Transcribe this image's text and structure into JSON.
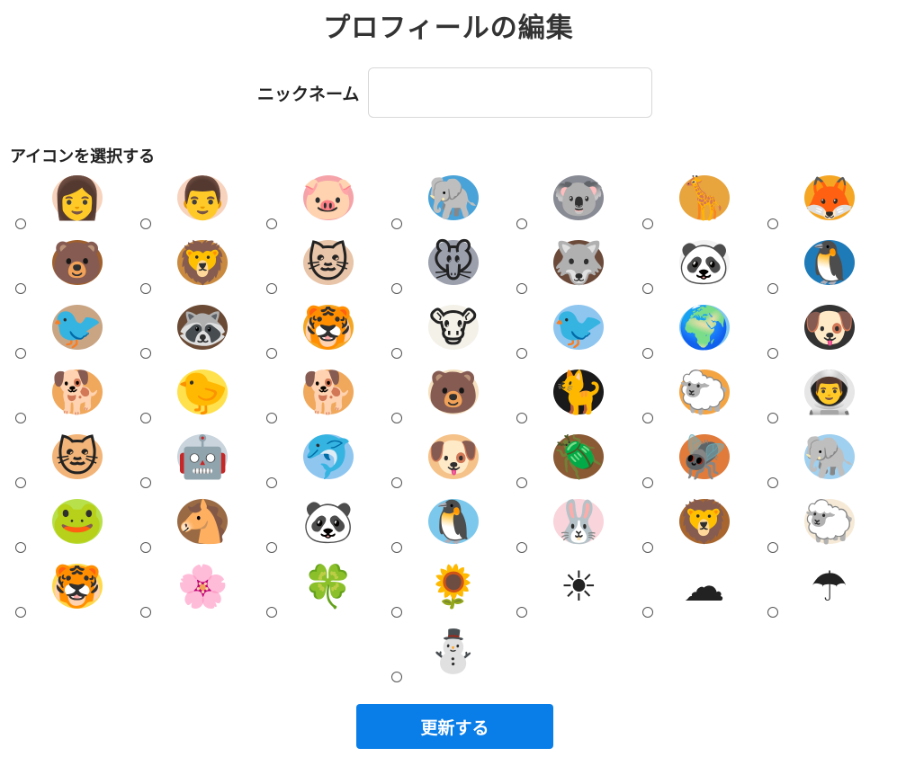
{
  "page": {
    "title": "プロフィールの編集",
    "nickname_label": "ニックネーム",
    "nickname_value": "",
    "nickname_placeholder": "",
    "icon_section_label": "アイコンを選択する",
    "update_button": "更新する"
  },
  "colors": {
    "accent": "#0a7ee8",
    "input_border": "#d8d8d8"
  },
  "icons": [
    {
      "name": "woman-icon",
      "glyph": "👩",
      "color": "#f7d3bd"
    },
    {
      "name": "man-icon",
      "glyph": "👨",
      "color": "#f7d3bd"
    },
    {
      "name": "pig-icon",
      "glyph": "🐷",
      "color": "#f5a3a8"
    },
    {
      "name": "elephant-icon",
      "glyph": "🐘",
      "color": "#4aa3d8"
    },
    {
      "name": "koala-icon",
      "glyph": "🐨",
      "color": "#888a94"
    },
    {
      "name": "giraffe-icon",
      "glyph": "🦒",
      "color": "#e8a43d"
    },
    {
      "name": "fox-icon",
      "glyph": "🦊",
      "color": "#f5a623"
    },
    {
      "name": "bear-icon",
      "glyph": "🐻",
      "color": "#a0602d"
    },
    {
      "name": "lion-icon",
      "glyph": "🦁",
      "color": "#c98a3f"
    },
    {
      "name": "cat-icon",
      "glyph": "🐱",
      "color": "#e8c4a8"
    },
    {
      "name": "mouse-icon",
      "glyph": "🐭",
      "color": "#9ca0ad"
    },
    {
      "name": "wolf-icon",
      "glyph": "🐺",
      "color": "#6b4a3a"
    },
    {
      "name": "panda-icon",
      "glyph": "🐼",
      "color": "#f2f2f2"
    },
    {
      "name": "penguin-icon",
      "glyph": "🐧",
      "color": "#1f7ab8"
    },
    {
      "name": "sparrow-icon",
      "glyph": "🐦",
      "color": "#c9a584"
    },
    {
      "name": "raccoon-icon",
      "glyph": "🦝",
      "color": "#6a4a34"
    },
    {
      "name": "tiger-icon",
      "glyph": "🐯",
      "color": "#f5a623"
    },
    {
      "name": "cow-icon",
      "glyph": "🐮",
      "color": "#f4f1e9"
    },
    {
      "name": "blue-bird-hat-icon",
      "glyph": "🐦",
      "color": "#8fc6f0"
    },
    {
      "name": "earth-icon",
      "glyph": "🌍",
      "color": "#7fc8ef"
    },
    {
      "name": "black-dog-icon",
      "glyph": "🐶",
      "color": "#333333"
    },
    {
      "name": "shiba-dog-icon",
      "glyph": "🐕",
      "color": "#f0a85c"
    },
    {
      "name": "chick-sunglasses-icon",
      "glyph": "🐤",
      "color": "#ffe14d"
    },
    {
      "name": "corgi-icon",
      "glyph": "🐕",
      "color": "#f0a85c"
    },
    {
      "name": "bear-cub-icon",
      "glyph": "🐻",
      "color": "#f5e1c0"
    },
    {
      "name": "black-cat-icon",
      "glyph": "🐈",
      "color": "#1a1a1a"
    },
    {
      "name": "sheep-girl-icon",
      "glyph": "🐑",
      "color": "#f5a442"
    },
    {
      "name": "astronaut-icon",
      "glyph": "👨‍🚀",
      "color": "#e6e6e6"
    },
    {
      "name": "cat-tabby-icon",
      "glyph": "🐱",
      "color": "#f2b478"
    },
    {
      "name": "robot-headphones-icon",
      "glyph": "🤖",
      "color": "#c9d4dc"
    },
    {
      "name": "dolphin-icon",
      "glyph": "🐬",
      "color": "#8fc6f0"
    },
    {
      "name": "dog-sailor-icon",
      "glyph": "🐶",
      "color": "#f5c28a"
    },
    {
      "name": "beetle-icon",
      "glyph": "🪲",
      "color": "#8a5a34"
    },
    {
      "name": "dragonfly-icon",
      "glyph": "🪰",
      "color": "#e07b3c"
    },
    {
      "name": "blue-elephant-icon",
      "glyph": "🐘",
      "color": "#9fd0ef"
    },
    {
      "name": "frog-icon",
      "glyph": "🐸",
      "color": "#b8e04a"
    },
    {
      "name": "horse-icon",
      "glyph": "🐴",
      "color": "#9a6a44"
    },
    {
      "name": "panda-face-icon",
      "glyph": "🐼",
      "color": "#ffffff"
    },
    {
      "name": "penguin-blue-icon",
      "glyph": "🐧",
      "color": "#7cc8ec"
    },
    {
      "name": "rabbit-icon",
      "glyph": "🐰",
      "color": "#f9d4da"
    },
    {
      "name": "lion-face-icon",
      "glyph": "🦁",
      "color": "#a8662e"
    },
    {
      "name": "sheep-icon",
      "glyph": "🐑",
      "color": "#f6ead7"
    },
    {
      "name": "tiger-face-icon",
      "glyph": "🐯",
      "color": "#ffd94a"
    },
    {
      "name": "cherry-blossom-icon",
      "glyph": "🌸",
      "color": "#ffffff"
    },
    {
      "name": "clover-icon",
      "glyph": "🍀",
      "color": "#ffffff"
    },
    {
      "name": "sunflower-icon",
      "glyph": "🌻",
      "color": "#ffffff"
    },
    {
      "name": "sun-icon",
      "glyph": "☀",
      "color": "#ffffff"
    },
    {
      "name": "cloud-icon",
      "glyph": "☁",
      "color": "#ffffff"
    },
    {
      "name": "umbrella-icon",
      "glyph": "☂",
      "color": "#ffffff"
    },
    {
      "name": "snowman-icon",
      "glyph": "⛄",
      "color": "#ffffff"
    }
  ]
}
